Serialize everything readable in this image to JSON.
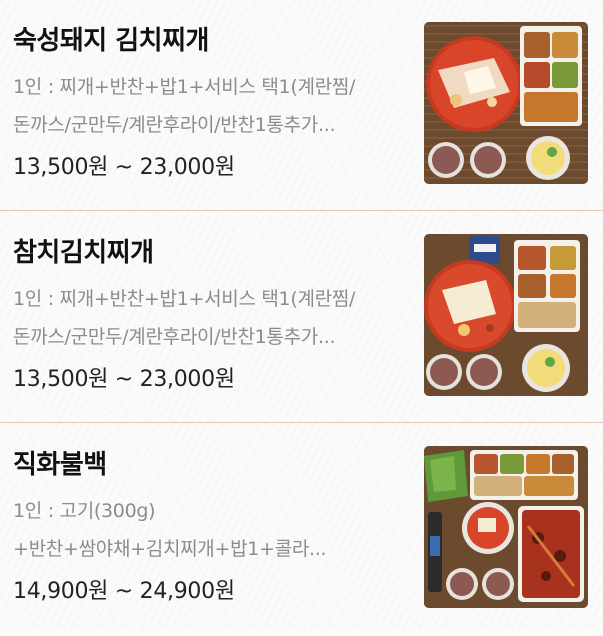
{
  "menu": {
    "items": [
      {
        "name": "숙성돼지 김치찌개",
        "desc_line1": "1인 : 찌개+반찬+밥1+서비스 택1(계란찜/",
        "desc_line2": "돈까스/군만두/계란후라이/반찬1통추가...",
        "price": "13,500원 ~ 23,000원",
        "image_icon": "kimchi-stew-set-photo"
      },
      {
        "name": "참치김치찌개",
        "desc_line1": "1인 : 찌개+반찬+밥1+서비스 택1(계란찜/",
        "desc_line2": "돈까스/군만두/계란후라이/반찬1통추가...",
        "price": "13,500원 ~ 23,000원",
        "image_icon": "tuna-kimchi-stew-set-photo"
      },
      {
        "name": "직화불백",
        "desc_line1": "1인 : 고기(300g)",
        "desc_line2": "+반찬+쌈야채+김치찌개+밥1+콜라...",
        "price": "14,900원 ~ 24,900원",
        "image_icon": "grilled-pork-set-photo"
      }
    ]
  },
  "colors": {
    "divider": "#e6c3b6",
    "desc": "#8c8c8c",
    "stew_red": "#d8452a"
  }
}
